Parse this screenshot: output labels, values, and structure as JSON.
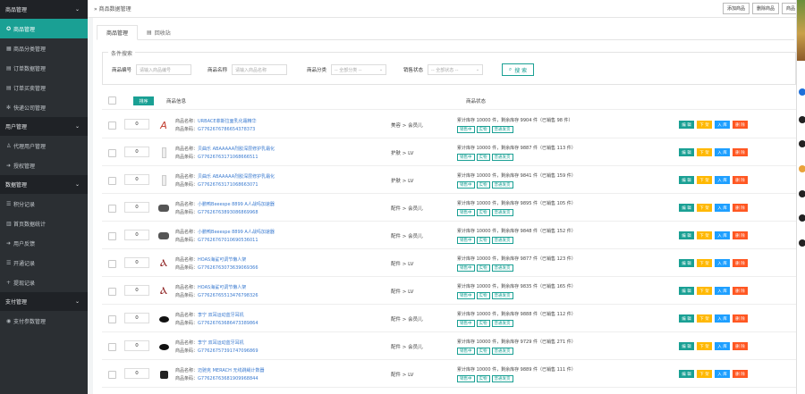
{
  "sidebar": {
    "sections": [
      {
        "title": "商品管理",
        "items": [
          {
            "label": "商品管理",
            "icon": "shield",
            "active": true
          },
          {
            "label": "商品分类管理",
            "icon": "grid"
          },
          {
            "label": "订单数据管理",
            "icon": "doc"
          },
          {
            "label": "订单买卖管理",
            "icon": "doc"
          },
          {
            "label": "快递公司管理",
            "icon": "gear"
          }
        ]
      },
      {
        "title": "用户管理",
        "items": [
          {
            "label": "代理用户管理",
            "icon": "user"
          },
          {
            "label": "授权管理",
            "icon": "arrow"
          }
        ]
      },
      {
        "title": "数据管理",
        "items": [
          {
            "label": "积分记录",
            "icon": "list"
          },
          {
            "label": "首页数据统计",
            "icon": "chart"
          },
          {
            "label": "用户反馈",
            "icon": "arrow"
          },
          {
            "label": "开通记录",
            "icon": "list"
          },
          {
            "label": "提现记录",
            "icon": "plus"
          }
        ]
      },
      {
        "title": "支付管理",
        "items": [
          {
            "label": "支付参数管理",
            "icon": "circle"
          }
        ]
      }
    ]
  },
  "topbar": {
    "breadcrumb": "商品数据管理",
    "buttons": [
      "添加商品",
      "删除商品",
      "商品"
    ]
  },
  "tabs": [
    {
      "label": "商品管理",
      "active": true
    },
    {
      "label": "回收站",
      "active": false
    }
  ],
  "search": {
    "legend": "条件搜索",
    "fields": [
      {
        "label": "商品编号",
        "placeholder": "请输入商品编号",
        "type": "input"
      },
      {
        "label": "商品名称",
        "placeholder": "请输入商品名称",
        "type": "input"
      },
      {
        "label": "商品分类",
        "placeholder": "-- 全部分类 --",
        "type": "select"
      },
      {
        "label": "销售状态",
        "placeholder": "-- 全部状态 --",
        "type": "select"
      }
    ],
    "button": "搜 索"
  },
  "table": {
    "sort_button": "排序",
    "col_product": "商品信息",
    "col_status": "商品状态",
    "name_prefix": "商品名称：",
    "barcode_prefix": "商品条码：",
    "tags": [
      "销售中",
      "实物",
      "普通发货"
    ],
    "actions": [
      "编 辑",
      "下 架",
      "入 库",
      "删 除"
    ],
    "rows": [
      {
        "qty": "0",
        "thumb": "red-a",
        "name": "URBACE菲斯拉面乳化霜精华",
        "barcode": "G7762676786654378373",
        "category": "美容 > 会员儿",
        "stock": "累计库存 10000 件，剩余库存 9904 件（已销售 98 件）"
      },
      {
        "qty": "0",
        "thumb": "white-bottle",
        "name": "贝曲乐 ABAAAAA烈胶深层修护乳霜化",
        "barcode": "G77626763171068666511",
        "category": "护肤 > LV",
        "stock": "累计库存 10000 件，剩余库存 9887 件（已销售 113 件）"
      },
      {
        "qty": "0",
        "thumb": "white-bottle",
        "name": "贝曲乐 ABAAAAA烈胶深层修护乳霜化",
        "barcode": "G77626763171068663071",
        "category": "护肤 > LV",
        "stock": "累计库存 10000 件，剩余库存 9841 件（已销售 159 件）"
      },
      {
        "qty": "0",
        "thumb": "grey-device",
        "name": "小鹏鸭Beeespe 8899 A人战吗加速器",
        "barcode": "G77626763893086869968",
        "category": "配件 > 会员儿",
        "stock": "累计库存 10000 件，剩余库存 9895 件（已销售 105 件）"
      },
      {
        "qty": "0",
        "thumb": "grey-device",
        "name": "小鹏鸭Beeespe 8899 A人战吗加速器",
        "barcode": "G77626767010690536011",
        "category": "配件 > 会员儿",
        "stock": "累计库存 10000 件，剩余库存 9848 件（已销售 152 件）"
      },
      {
        "qty": "0",
        "thumb": "red-stand",
        "name": "HOAS海鲨可调节懒人架",
        "barcode": "G77626763073639069366",
        "category": "配件 > LV",
        "stock": "累计库存 10000 件，剩余库存 9877 件（已销售 123 件）"
      },
      {
        "qty": "0",
        "thumb": "red-stand",
        "name": "HOAS海鲨可调节懒人架",
        "barcode": "G77626765513476798326",
        "category": "配件 > LV",
        "stock": "累计库存 10000 件，剩余库存 9835 件（已销售 165 件）"
      },
      {
        "qty": "0",
        "thumb": "black-earbuds",
        "name": "李宁 双耳运动蓝牙耳机",
        "barcode": "G77626763686473389864",
        "category": "配件 > 会员儿",
        "stock": "累计库存 10000 件，剩余库存 9888 件（已销售 112 件）"
      },
      {
        "qty": "0",
        "thumb": "black-earbuds",
        "name": "李宁 双耳运动蓝牙耳机",
        "barcode": "G77626757391747096869",
        "category": "配件 > 会员儿",
        "stock": "累计库存 10000 件，剩余库存 9729 件（已销售 271 件）"
      },
      {
        "qty": "0",
        "thumb": "black-device",
        "name": "迈驰克 MERACH 无线跳绳计数器",
        "barcode": "G77626763681909968844",
        "category": "配件 > LV",
        "stock": "累计库存 10000 件，剩余库存 9889 件（已销售 111 件）"
      }
    ]
  },
  "colors": {
    "accent": "#1aa094",
    "sidebar": "#2b2f33",
    "warn": "#ffb800",
    "info": "#1e9fff",
    "danger": "#ff5722"
  }
}
